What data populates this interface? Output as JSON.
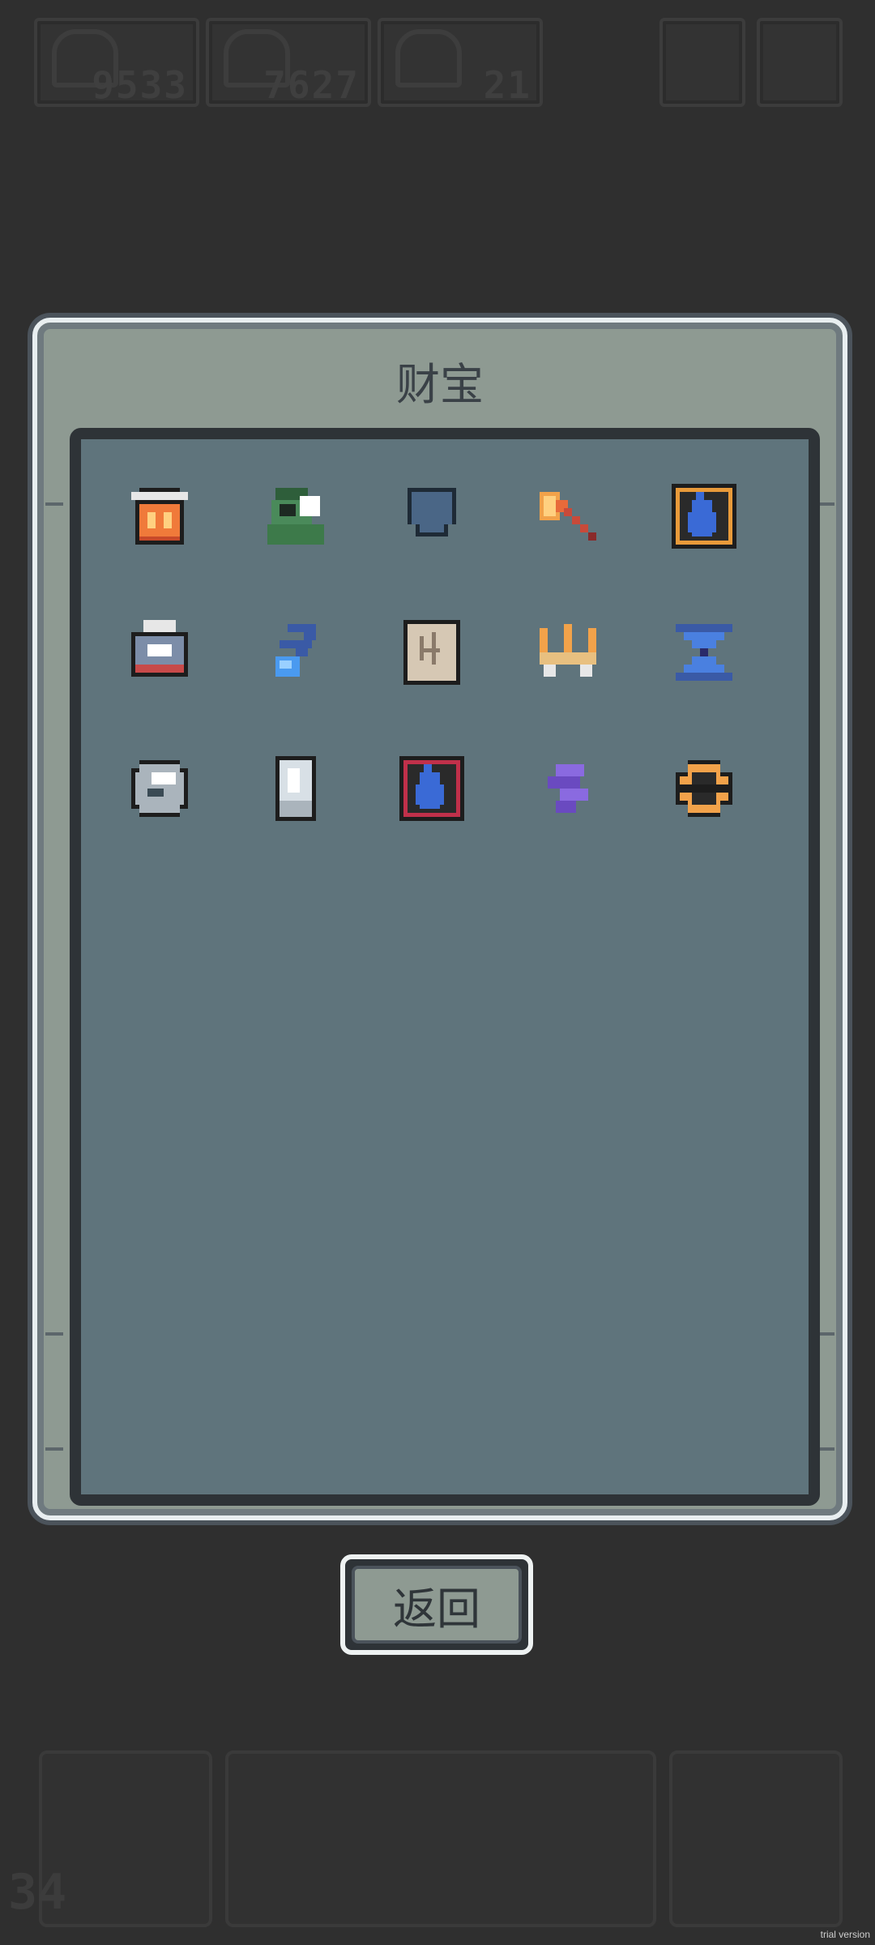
{
  "hud": {
    "resources": [
      {
        "icon": "meat-icon",
        "value": "9533"
      },
      {
        "icon": "coin-pile-icon",
        "value": "7627"
      },
      {
        "icon": "gem-pile-icon",
        "value": "21"
      }
    ]
  },
  "panel": {
    "title": "财宝",
    "items": [
      {
        "name": "lantern-icon"
      },
      {
        "name": "green-hood-icon"
      },
      {
        "name": "shield-icon"
      },
      {
        "name": "axe-icon"
      },
      {
        "name": "blue-flame-frame-icon"
      },
      {
        "name": "locked-chest-icon"
      },
      {
        "name": "blue-feather-icon"
      },
      {
        "name": "parchment-scroll-icon"
      },
      {
        "name": "golden-crown-icon"
      },
      {
        "name": "hourglass-icon"
      },
      {
        "name": "silver-orb-icon"
      },
      {
        "name": "mirror-stone-icon"
      },
      {
        "name": "red-flame-frame-icon"
      },
      {
        "name": "purple-claw-icon"
      },
      {
        "name": "golden-ring-icon"
      }
    ]
  },
  "back_button": {
    "label": "返回"
  },
  "bottom": {
    "level": "34"
  },
  "watermark": "trial version"
}
